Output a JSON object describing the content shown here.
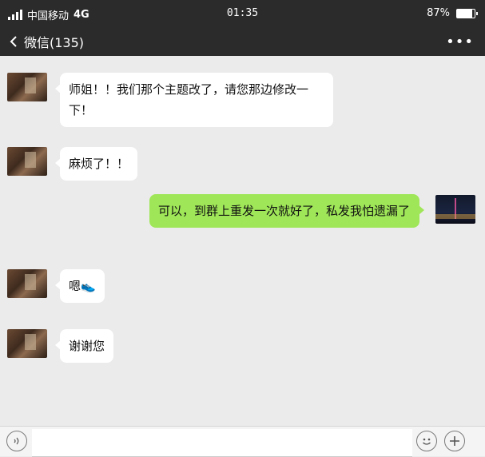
{
  "status": {
    "carrier": "中国移动",
    "network": "4G",
    "time": "01:35",
    "battery": "87%",
    "battery_level": 0.87
  },
  "nav": {
    "back_label": "微信(135)",
    "more_label": "•••"
  },
  "messages": [
    {
      "side": "in",
      "text": "师姐！！我们那个主题改了，请您那边修改一下！"
    },
    {
      "side": "in",
      "text": "麻烦了！！"
    },
    {
      "side": "out",
      "text": "可以，到群上重发一次就好了，私发我怕遗漏了"
    },
    {
      "side": "in",
      "text": "嗯👟"
    },
    {
      "side": "in",
      "text": "谢谢您"
    }
  ],
  "input": {
    "placeholder": ""
  },
  "icons": {
    "back": "chevron-left-icon",
    "more": "more-icon",
    "voice": "voice-icon",
    "emoji": "emoji-icon",
    "plus": "plus-icon"
  }
}
